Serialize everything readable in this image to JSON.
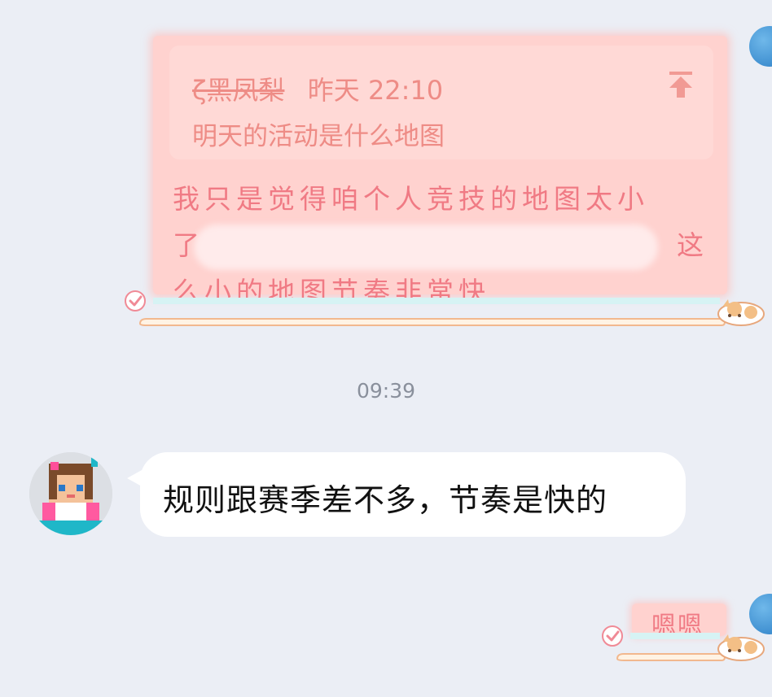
{
  "conversation": {
    "messages": [
      {
        "direction": "outgoing",
        "quote": {
          "author": "ζ黑凤梨",
          "time": "昨天 22:10",
          "text": "明天的活动是什么地图"
        },
        "text_line1": "我只是觉得咱个人竞技的地图太小",
        "text_line2_start": "了",
        "text_line2_end": "这",
        "text_line3": "么小的地图节奏非常快"
      },
      {
        "direction": "timestamp",
        "text": "09:39"
      },
      {
        "direction": "incoming",
        "text": "规则跟赛季差不多，节奏是快的"
      },
      {
        "direction": "outgoing",
        "text": "嗯嗯"
      }
    ]
  },
  "colors": {
    "background": "#ebeef5",
    "outgoing_bubble": "#ffd2cf",
    "outgoing_text": "#f07a84",
    "incoming_bubble": "#ffffff",
    "timestamp_text": "#8a909c"
  },
  "icons": [
    "jump-to-quote-icon",
    "read-check-icon",
    "cat-decoration"
  ]
}
